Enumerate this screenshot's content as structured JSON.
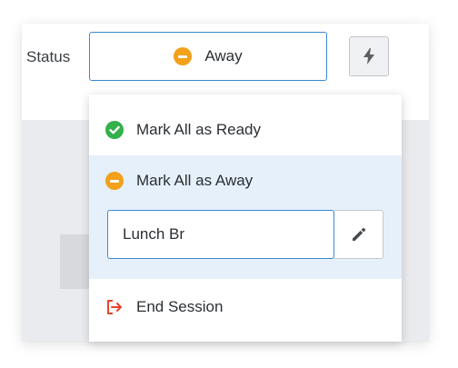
{
  "header": {
    "status_label": "Status",
    "status_value": "Away",
    "status_icon": "away-minus-icon",
    "quick_action_icon": "bolt-icon"
  },
  "menu": {
    "mark_ready": {
      "label": "Mark All as Ready",
      "icon": "check-circle-icon",
      "color": "#33b04a"
    },
    "mark_away": {
      "label": "Mark All as Away",
      "icon": "minus-circle-icon",
      "color": "#f3a01a"
    },
    "away_reason": {
      "value": "Lunch Br",
      "edit_icon": "pencil-icon"
    },
    "end_session": {
      "label": "End Session",
      "icon": "sign-out-icon",
      "color": "#e8452c"
    }
  },
  "colors": {
    "focus_border": "#3a89d1",
    "highlight_bg": "#e5f0fb"
  }
}
